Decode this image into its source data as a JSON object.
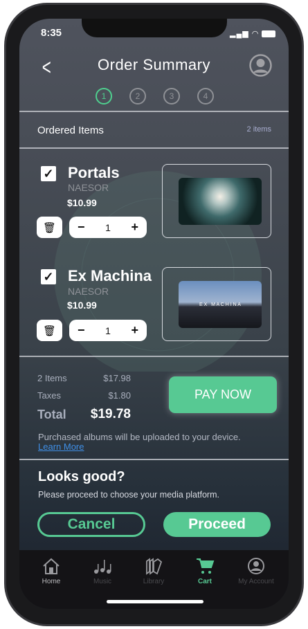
{
  "status": {
    "time": "8:35"
  },
  "header": {
    "title": "Order Summary"
  },
  "steps": [
    "1",
    "2",
    "3",
    "4"
  ],
  "ordered": {
    "label": "Ordered Items",
    "count": "2 items"
  },
  "items": [
    {
      "title": "Portals",
      "artist": "NAESOR",
      "price": "$10.99",
      "quantity": "1"
    },
    {
      "title": "Ex Machina",
      "artist": "NAESOR",
      "price": "$10.99",
      "quantity": "1",
      "art_text": "E X   M A C H I N A"
    }
  ],
  "summary": {
    "items_label": "2 Items",
    "items_value": "$17.98",
    "taxes_label": "Taxes",
    "taxes_value": "$1.80",
    "total_label": "Total",
    "total_value": "$19.78",
    "pay_label": "PAY NOW",
    "note": "Purchased albums will be uploaded to your device.",
    "learn_more": "Learn More"
  },
  "confirm": {
    "heading": "Looks good?",
    "sub": "Please proceed to choose your media platform.",
    "cancel": "Cancel",
    "proceed": "Proceed"
  },
  "tabs": [
    {
      "label": "Home"
    },
    {
      "label": "Music"
    },
    {
      "label": "Library"
    },
    {
      "label": "Cart"
    },
    {
      "label": "My Account"
    }
  ],
  "colors": {
    "accent": "#57c993",
    "link": "#3f8fe6"
  }
}
